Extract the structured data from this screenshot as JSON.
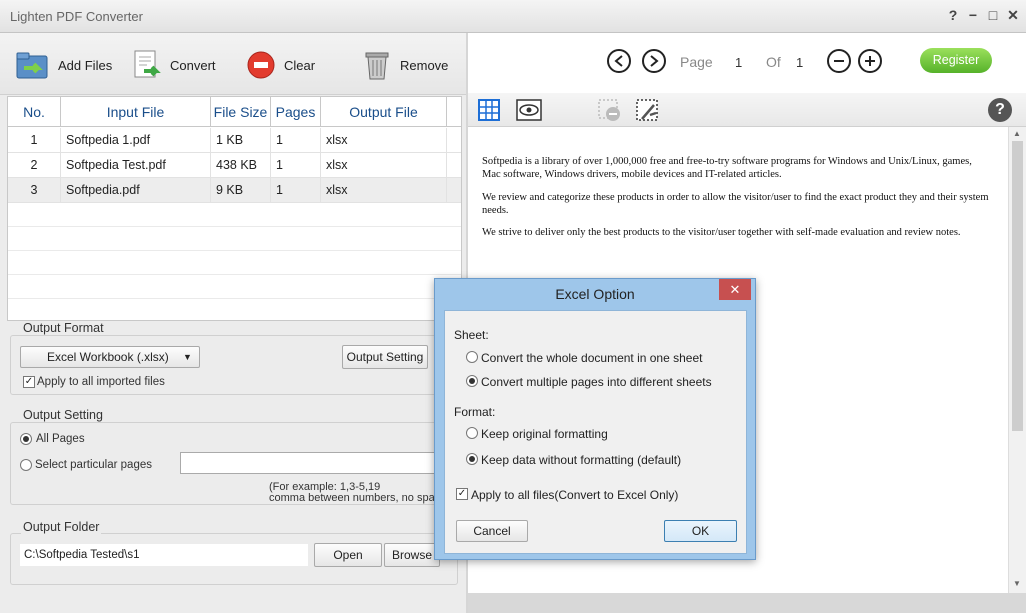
{
  "app": {
    "title": "Lighten PDF Converter",
    "help_glyph": "?",
    "min_glyph": "−",
    "max_glyph": "□",
    "close_glyph": "✕"
  },
  "toolbar": {
    "add_files": "Add Files",
    "convert": "Convert",
    "clear": "Clear",
    "remove": "Remove"
  },
  "table": {
    "headers": [
      "No.",
      "Input File",
      "File Size",
      "Pages",
      "Output File"
    ],
    "rows": [
      [
        "1",
        "Softpedia 1.pdf",
        "1 KB",
        "1",
        "xlsx"
      ],
      [
        "2",
        "Softpedia Test.pdf",
        "438 KB",
        "1",
        "xlsx"
      ],
      [
        "3",
        "Softpedia.pdf",
        "9 KB",
        "1",
        "xlsx"
      ]
    ]
  },
  "output_format": {
    "legend": "Output Format",
    "selected": "Excel Workbook (.xlsx)",
    "setting_button": "Output Setting",
    "apply_all": "Apply to all imported files"
  },
  "output_setting": {
    "legend": "Output Setting",
    "all_pages": "All Pages",
    "particular_pages": "Select particular pages",
    "example_line1": "(For example: 1,3-5,19",
    "example_line2": "comma between numbers, no spac"
  },
  "output_folder": {
    "legend": "Output Folder",
    "path": "C:\\Softpedia Tested\\s1",
    "open_button": "Open",
    "browse_button": "Browse"
  },
  "viewer": {
    "page_label": "Page",
    "page_current": "1",
    "of_label": "Of",
    "page_total": "1",
    "register": "Register",
    "help": "?",
    "paragraphs": [
      "Softpedia is a library of over 1,000,000 free and free-to-try software programs for Windows and Unix/Linux, games, Mac software, Windows drivers, mobile devices and IT-related articles.",
      "We review and categorize these products in order to allow the visitor/user to find the exact product they and their system needs.",
      "We strive to deliver only the best products to the visitor/user together with self-made evaluation and review notes."
    ]
  },
  "dialog": {
    "title": "Excel Option",
    "close_glyph": "✕",
    "sheet_label": "Sheet:",
    "sheet_option_1": "Convert the whole document in one sheet",
    "sheet_option_2": "Convert multiple pages into different sheets",
    "format_label": "Format:",
    "format_option_1": "Keep original formatting",
    "format_option_2": "Keep data without formatting (default)",
    "apply_all": "Apply to all files(Convert to Excel Only)",
    "cancel": "Cancel",
    "ok": "OK"
  },
  "colors": {
    "accent_header": "#1a4e8a",
    "register_green": "#56b22a",
    "dialog_frame": "#9ec6ea",
    "dialog_close": "#c75050"
  }
}
